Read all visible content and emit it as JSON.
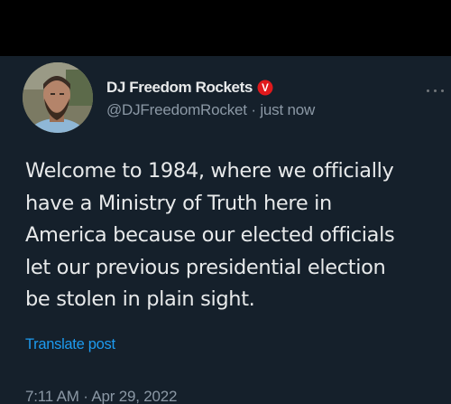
{
  "author": {
    "display_name": "DJ Freedom Rockets",
    "badge_icon": "verified-v-badge-icon",
    "badge_letter": "V",
    "badge_color": "#e0191c",
    "handle": "@DJFreedomRocket",
    "separator": "·",
    "relative_time": "just now",
    "avatar_icon": "profile-photo-avatar"
  },
  "more_icon": "more-options-icon",
  "tweet": {
    "lines": [
      "Welcome to 1984, where we officially",
      "have a Ministry of Truth here in",
      "America because our elected officials",
      "let our previous presidential election",
      "be stolen in plain sight."
    ]
  },
  "translate_label": "Translate post",
  "timestamp": {
    "time": "7:11 AM",
    "separator": "·",
    "date": "Apr 29, 2022"
  },
  "colors": {
    "background": "#15202b",
    "top_bar": "#000000",
    "primary_text": "#e7e9ea",
    "secondary_text": "#8b98a5",
    "link": "#1d9bf0"
  }
}
